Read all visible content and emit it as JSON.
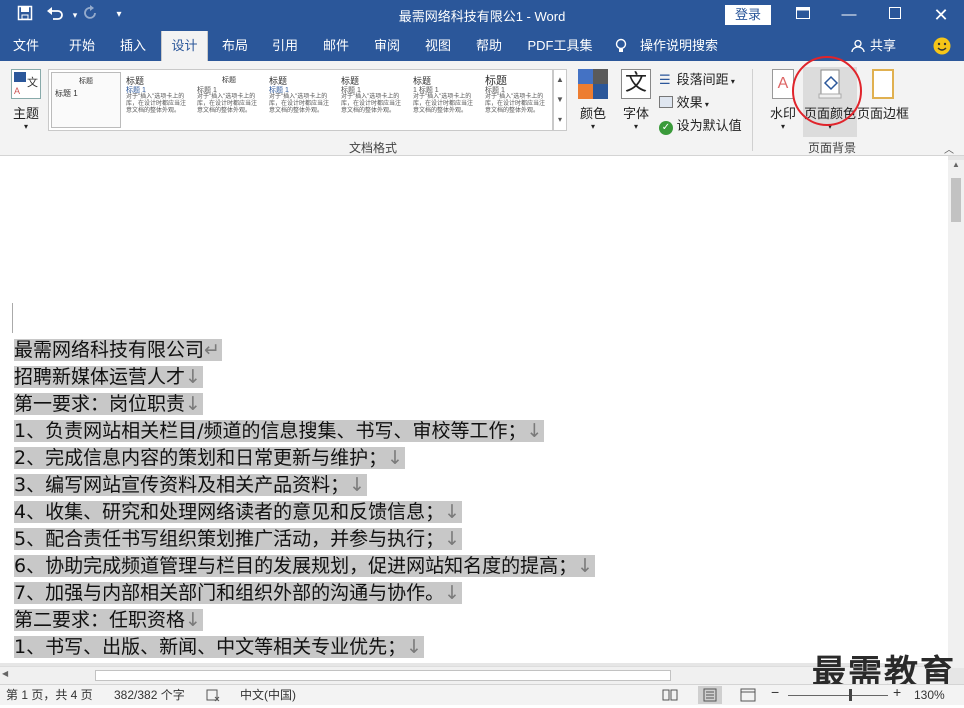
{
  "titlebar": {
    "title": "最需网络科技有限公1 - Word",
    "login_label": "登录",
    "quick_access": [
      "save-icon",
      "undo-icon",
      "redo-icon",
      "customize-icon"
    ],
    "window_buttons": [
      "ribbon-display-icon",
      "minimize-icon",
      "maximize-icon",
      "close-icon"
    ]
  },
  "tabs": {
    "items": [
      "文件",
      "开始",
      "插入",
      "设计",
      "布局",
      "引用",
      "邮件",
      "审阅",
      "视图",
      "帮助",
      "PDF工具集"
    ],
    "active": "设计",
    "tell_me": "操作说明搜索",
    "share": "共享"
  },
  "ribbon": {
    "theme_label": "主题",
    "gallery": [
      {
        "heading": "标题",
        "sub": "标题 1",
        "body": ""
      },
      {
        "heading": "标题",
        "sub": "标题 1",
        "body": "对于\"插入\"选项卡上的库，在设计时都应当注意文档的整体外观。"
      },
      {
        "heading": "标题",
        "sub": "标题 1",
        "body": "对于\"插入\"选项卡上的库，在设计时都应当注意文档的整体外观。"
      },
      {
        "heading": "标题",
        "sub": "标题 1",
        "body": "对于\"插入\"选项卡上的库，在设计时都应当注意文档的整体外观。"
      },
      {
        "heading": "标题",
        "sub": "标题 1",
        "body": "对于\"插入\"选项卡上的库，在设计时都应当注意文档的整体外观。"
      },
      {
        "heading": "标题",
        "sub": "1 标题 1",
        "body": "对于\"插入\"选项卡上的库，在设计时都应当注意文档的整体外观。"
      },
      {
        "heading": "标题",
        "sub": "标题 1",
        "body": "对于\"插入\"选项卡上的库，在设计时都应当注意文档的整体外观。"
      }
    ],
    "colors_label": "颜色",
    "fonts_label": "字体",
    "paragraph_spacing_label": "段落间距",
    "effects_label": "效果",
    "set_default_label": "设为默认值",
    "group_document_format": "文档格式",
    "watermark_label": "水印",
    "page_color_label": "页面颜色",
    "page_borders_label": "页面边框",
    "group_page_background": "页面背景"
  },
  "document": {
    "lines": [
      {
        "text": "最需网络科技有限公司",
        "mark": "↵"
      },
      {
        "text": "招聘新媒体运营人才",
        "mark": "↓"
      },
      {
        "text": "第一要求：岗位职责",
        "mark": "↓"
      },
      {
        "text": "1、负责网站相关栏目/频道的信息搜集、书写、审校等工作；",
        "mark": "↓"
      },
      {
        "text": "2、完成信息内容的策划和日常更新与维护；",
        "mark": "↓"
      },
      {
        "text": "3、编写网站宣传资料及相关产品资料；",
        "mark": "↓"
      },
      {
        "text": "4、收集、研究和处理网络读者的意见和反馈信息；",
        "mark": "↓"
      },
      {
        "text": "5、配合责任书写组织策划推广活动，并参与执行；",
        "mark": "↓"
      },
      {
        "text": "6、协助完成频道管理与栏目的发展规划，促进网站知名度的提高；",
        "mark": "↓"
      },
      {
        "text": "7、加强与内部相关部门和组织外部的沟通与协作。",
        "mark": "↓"
      },
      {
        "text": "第二要求：任职资格",
        "mark": "↓"
      },
      {
        "text": "1、书写、出版、新闻、中文等相关专业优先；",
        "mark": "↓"
      }
    ]
  },
  "status": {
    "page": "第 1 页，共 4 页",
    "words": "382/382 个字",
    "language": "中文(中国)",
    "zoom": "130%",
    "zoom_level": 0.62
  },
  "watermark_text": "最需教育",
  "colors": {
    "accent": "#2b579a",
    "selection": "#c8c8c8",
    "highlight_circle": "#e0242b"
  }
}
